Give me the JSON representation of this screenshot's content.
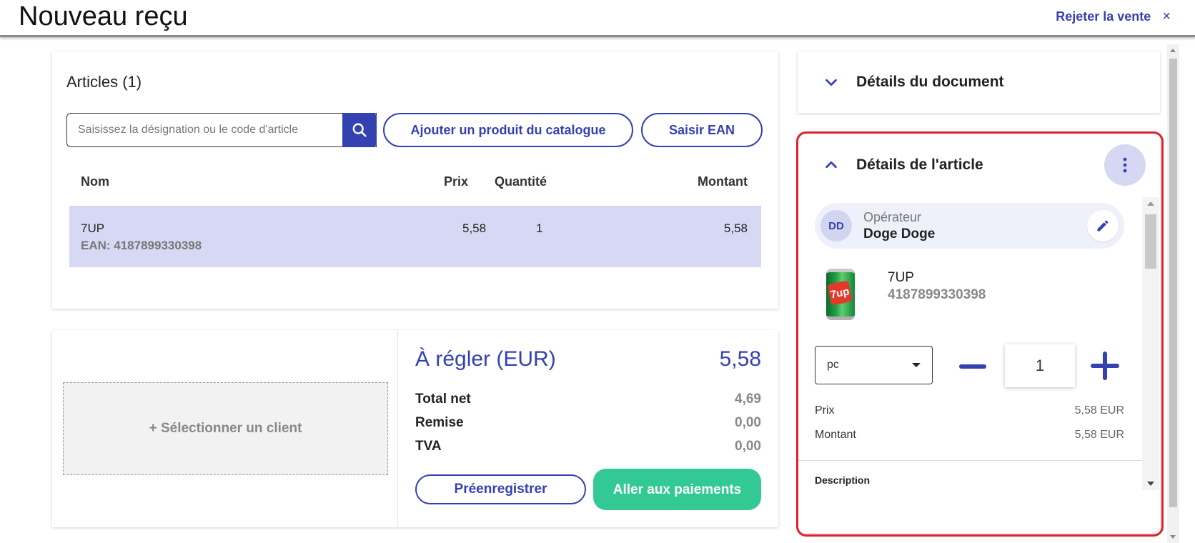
{
  "header": {
    "title": "Nouveau reçu",
    "reject_label": "Rejeter la vente",
    "close_symbol": "×"
  },
  "articles": {
    "title": "Articles (1)",
    "search_placeholder": "Saisissez la désignation ou le code d'article",
    "add_catalog_label": "Ajouter un produit du catalogue",
    "enter_ean_label": "Saisir EAN",
    "columns": {
      "name": "Nom",
      "price": "Prix",
      "quantity": "Quantité",
      "amount": "Montant"
    },
    "rows": [
      {
        "name": "7UP",
        "ean": "EAN: 4187899330398",
        "price": "5,58",
        "quantity": "1",
        "amount": "5,58"
      }
    ]
  },
  "summary": {
    "select_client_label": "+ Sélectionner un client",
    "due_label": "À régler (EUR)",
    "due_value": "5,58",
    "lines": [
      {
        "label": "Total net",
        "value": "4,69"
      },
      {
        "label": "Remise",
        "value": "0,00"
      },
      {
        "label": "TVA",
        "value": "0,00"
      }
    ],
    "preregister_label": "Préenregistrer",
    "pay_label": "Aller aux paiements"
  },
  "document_details": {
    "title": "Détails du document",
    "expanded": false
  },
  "article_details": {
    "title": "Détails de l'article",
    "expanded": true,
    "operator": {
      "initials": "DD",
      "label": "Opérateur",
      "name": "Doge Doge"
    },
    "product": {
      "name": "7UP",
      "ean": "4187899330398",
      "image_icon": "soda-can-icon",
      "logo_text": "7up"
    },
    "unit": "pc",
    "quantity": "1",
    "price_label": "Prix",
    "price_value": "5,58 EUR",
    "amount_label": "Montant",
    "amount_value": "5,58 EUR",
    "description_label": "Description"
  },
  "colors": {
    "primary": "#3441b0",
    "primary_light": "#d7d9f4",
    "pay_green": "#33c994",
    "highlight": "#e0202b"
  }
}
